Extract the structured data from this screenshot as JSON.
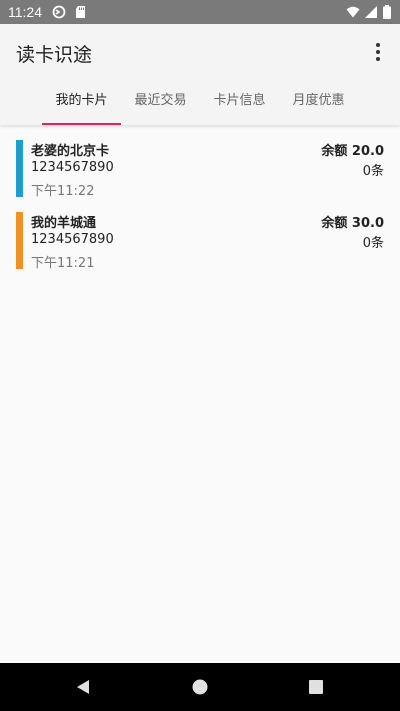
{
  "status_bar": {
    "time": "11:24",
    "icons": [
      "sync-icon",
      "sd-card-icon",
      "wifi-icon",
      "signal-icon",
      "battery-icon"
    ]
  },
  "app_bar": {
    "title": "读卡识途",
    "menu_icon": "more-vert-icon"
  },
  "tabs": [
    {
      "label": "我的卡片",
      "active": true
    },
    {
      "label": "最近交易",
      "active": false
    },
    {
      "label": "卡片信息",
      "active": false
    },
    {
      "label": "月度优惠",
      "active": false
    }
  ],
  "cards": [
    {
      "name": "老婆的北京卡",
      "number": "1234567890",
      "time": "下午11:22",
      "balance": "余额 20.0",
      "count": "0条",
      "color": "#1a9fd0"
    },
    {
      "name": "我的羊城通",
      "number": "1234567890",
      "time": "下午11:21",
      "balance": "余额 30.0",
      "count": "0条",
      "color": "#f39220"
    }
  ],
  "nav_bar": {
    "icons": [
      "back-icon",
      "home-icon",
      "recents-icon"
    ]
  },
  "colors": {
    "accent": "#e91e63",
    "status_bar": "#7a7a7a",
    "nav_bar": "#000000"
  }
}
